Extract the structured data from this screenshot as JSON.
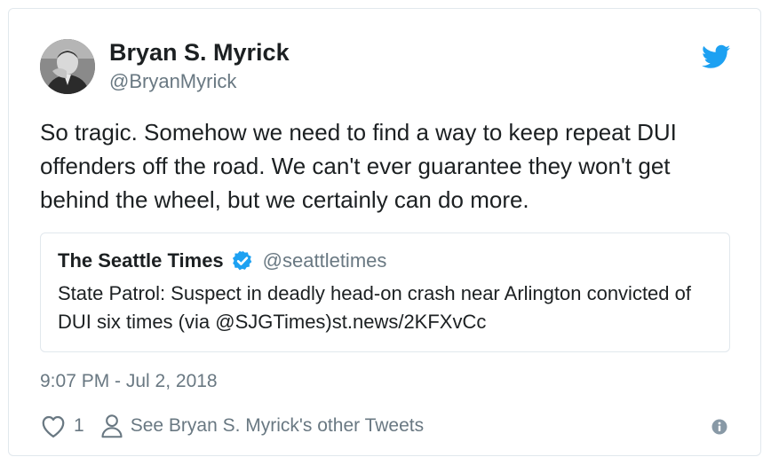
{
  "author": {
    "name": "Bryan S. Myrick",
    "handle": "@BryanMyrick"
  },
  "tweet": {
    "text": "So tragic. Somehow we need to find a way to keep repeat DUI offenders off the road. We can't ever guarantee they won't get behind the wheel, but we certainly can do more.",
    "timestamp": "9:07 PM - Jul 2, 2018"
  },
  "quoted": {
    "name": "The Seattle Times",
    "handle": "@seattletimes",
    "text": "State Patrol: Suspect in deadly head-on crash near Arlington convicted of DUI six times (via @SJGTimes)st.news/2KFXvCc"
  },
  "actions": {
    "like_count": "1",
    "other_tweets_label": "See Bryan S. Myrick's other Tweets"
  },
  "colors": {
    "twitter_blue": "#1da1f2",
    "text": "#1c2022",
    "muted": "#697882",
    "border": "#e1e8ed"
  },
  "icons": {
    "brand": "twitter-bird-icon",
    "verified": "verified-badge-icon",
    "like": "heart-icon",
    "profile": "person-icon",
    "info": "info-icon"
  }
}
